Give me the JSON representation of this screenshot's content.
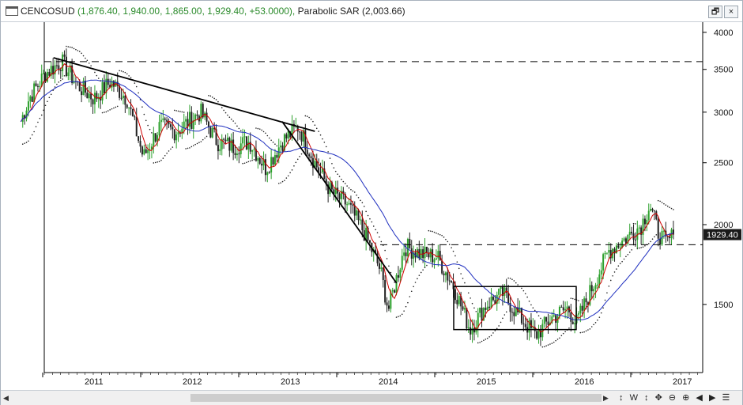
{
  "window": {
    "symbol": "CENCOSUD",
    "values": "(1,876.40, 1,940.00, 1,865.00, 1,929.40, +53.0000),",
    "indicator": "Parabolic SAR (2,003.66)",
    "restore_label": "🗗",
    "close_label": "×"
  },
  "price_label": "1929.40",
  "toolbar": {
    "items": [
      "↕",
      "W",
      "↕",
      "✥",
      "⊖",
      "⊕",
      "◀",
      "▶",
      "☰"
    ]
  },
  "scroll": {
    "left": "◀",
    "right": "▶"
  },
  "colors": {
    "up_candle": "#2ca02c",
    "down_candle": "#222222",
    "fast_ma": "#d00000",
    "slow_ma": "#1f2fbf",
    "sar": "#222222",
    "price_tag_bg": "#1a1a1a"
  },
  "chart_data": {
    "type": "candlestick",
    "y_scale": "log",
    "y_ticks": [
      1500,
      2000,
      2500,
      3000,
      3500,
      4000
    ],
    "y_tick_labels": [
      "1500",
      "2000",
      "2500",
      "3000",
      "3500",
      "4000"
    ],
    "x_ticks": [
      "2011",
      "2012",
      "2013",
      "2014",
      "2015",
      "2016",
      "2017"
    ],
    "last_close": 1929.4,
    "horizontal_lines": [
      {
        "style": "dashed",
        "value": 3600
      },
      {
        "style": "dashed",
        "value": 1860
      }
    ],
    "trendlines": [
      {
        "from": [
          "2010-09",
          3650
        ],
        "to": [
          "2013-05",
          2800
        ]
      },
      {
        "from": [
          "2013-01",
          2900
        ],
        "to": [
          "2014-03",
          1620
        ]
      }
    ],
    "rectangle": {
      "from": [
        "2014-10",
        1370
      ],
      "to": [
        "2016-01",
        1600
      ]
    },
    "price_path": [
      [
        "2010-05",
        2900
      ],
      [
        "2010-06",
        3150
      ],
      [
        "2010-08",
        3450
      ],
      [
        "2010-10",
        3600
      ],
      [
        "2010-12",
        3300
      ],
      [
        "2011-02",
        3150
      ],
      [
        "2011-04",
        3350
      ],
      [
        "2011-06",
        3150
      ],
      [
        "2011-08",
        2550
      ],
      [
        "2011-10",
        2850
      ],
      [
        "2011-12",
        2800
      ],
      [
        "2012-03",
        3000
      ],
      [
        "2012-05",
        2700
      ],
      [
        "2012-07",
        2650
      ],
      [
        "2012-09",
        2700
      ],
      [
        "2012-11",
        2450
      ],
      [
        "2013-01",
        2700
      ],
      [
        "2013-03",
        2850
      ],
      [
        "2013-05",
        2500
      ],
      [
        "2013-07",
        2250
      ],
      [
        "2013-09",
        2150
      ],
      [
        "2013-11",
        1950
      ],
      [
        "2014-01",
        1700
      ],
      [
        "2014-02",
        1470
      ],
      [
        "2014-04",
        1850
      ],
      [
        "2014-06",
        1800
      ],
      [
        "2014-08",
        1780
      ],
      [
        "2014-10",
        1600
      ],
      [
        "2014-12",
        1370
      ],
      [
        "2015-02",
        1500
      ],
      [
        "2015-04",
        1560
      ],
      [
        "2015-06",
        1440
      ],
      [
        "2015-08",
        1340
      ],
      [
        "2015-10",
        1430
      ],
      [
        "2015-12",
        1480
      ],
      [
        "2016-01",
        1400
      ],
      [
        "2016-03",
        1600
      ],
      [
        "2016-05",
        1820
      ],
      [
        "2016-07",
        1900
      ],
      [
        "2016-09",
        2000
      ],
      [
        "2016-10",
        2150
      ],
      [
        "2016-11",
        1950
      ],
      [
        "2016-12",
        1870
      ],
      [
        "2017-01",
        1929.4
      ]
    ]
  }
}
